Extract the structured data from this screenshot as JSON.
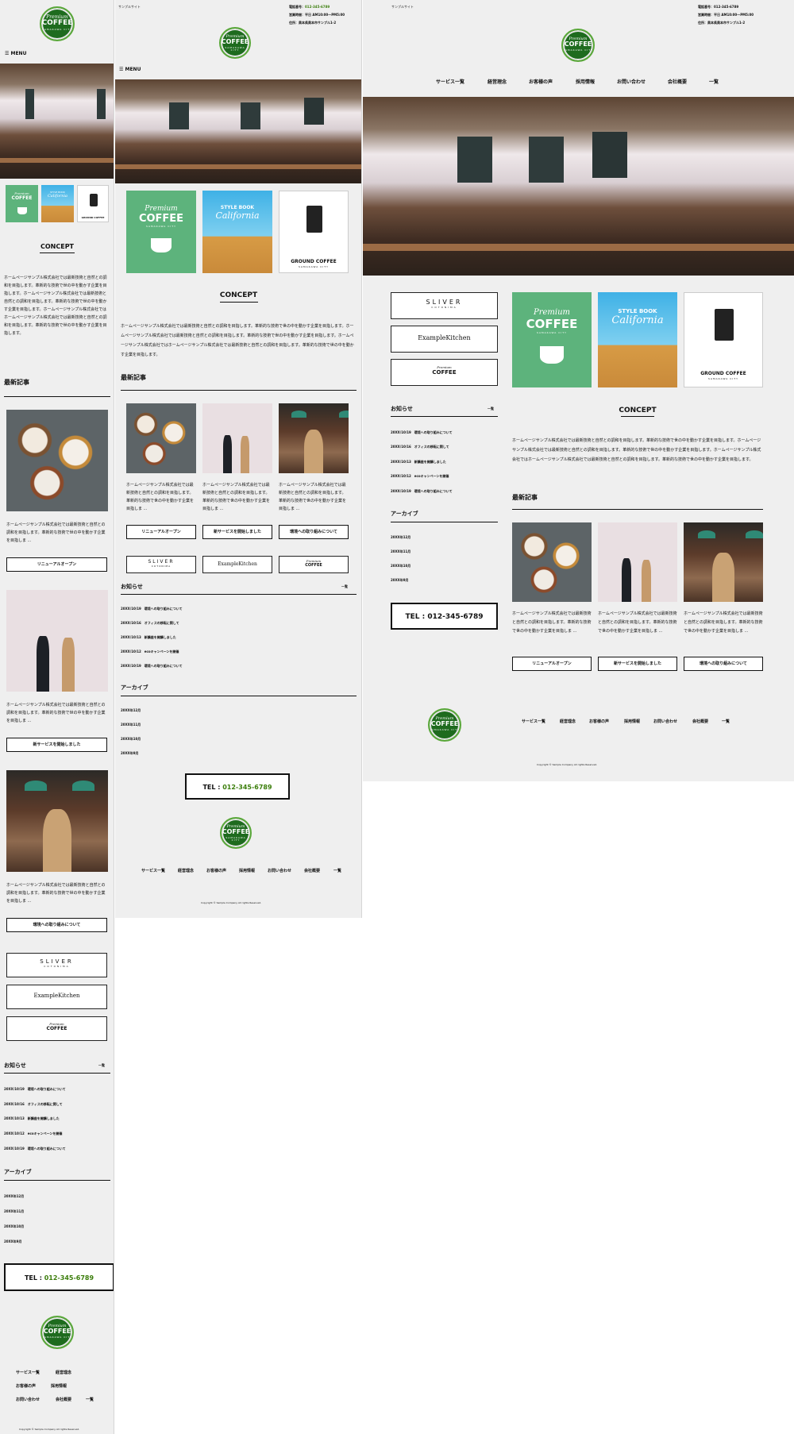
{
  "site": {
    "name": "サンプルサイト",
    "logo": {
      "line1": "Premium",
      "line2": "COFFEE",
      "line3": "SAMAKAWA CITY"
    },
    "phone_label": "電話番号：",
    "phone": "012-345-6789",
    "hours": "営業時間：平日 AM10:00〜PM5:00",
    "address": "住所：奥本県奥本市サンプル1-2"
  },
  "menu_label": "MENU",
  "nav": [
    "サービス一覧",
    "経営理念",
    "お客様の声",
    "採用情報",
    "お問い合わせ",
    "会社概要",
    "一覧"
  ],
  "tiles": {
    "premium": {
      "line1": "Premium",
      "line2": "COFFEE",
      "line3": "SAMAKAWA CITY"
    },
    "california": {
      "line1": "STYLE BOOK",
      "line2": "California"
    },
    "ground": {
      "line1": "GROUND COFFEE",
      "line2": "SAMAKAWA CITY"
    }
  },
  "concept": {
    "title": "CONCEPT",
    "text": "ホームページサンプル株式会社では最新技術と自然との調和を目指します。革新的な技術で世の中を動かす企業を目指します。ホームページサンプル株式会社では最新技術と自然との調和を目指します。革新的な技術で世の中を動かす企業を目指します。ホームページサンプル株式会社ではホームページサンプル株式会社では最新技術と自然との調和を目指します。革新的な技術で世の中を動かす企業を目指します。"
  },
  "latest": {
    "title": "最新記事",
    "excerpt": "ホームページサンプル株式会社では最新技術と自然との調和を目指します。革新的な技術で世の中を動かす企業を目指しま ...",
    "buttons": [
      "リニューアルオープン",
      "新サービスを開始しました",
      "環境への取り組みについて"
    ]
  },
  "banners": {
    "sliver": {
      "line1": "SLIVER",
      "line2": "COTONIMA"
    },
    "kitchen": {
      "line1": "ExampleKitchen"
    },
    "coffee": {
      "line1": "Premium",
      "line2": "COFFEE"
    }
  },
  "news": {
    "title": "お知らせ",
    "more": "一覧",
    "items": [
      "20XX/10/19　環境への取り組みについて",
      "20XX/10/16　オフィスの移転に関して",
      "20XX/10/13　新講座を開講しました",
      "20XX/10/12　ecoキャンペーンを開催",
      "20XX/10/19　環境への取り組みについて"
    ]
  },
  "archive": {
    "title": "アーカイブ",
    "items": [
      "20XX年12月",
      "20XX年11月",
      "20XX年10月",
      "20XX年9月"
    ]
  },
  "tel": {
    "label": "TEL : ",
    "number": "012-345-6789"
  },
  "copyright": "Copyright © Sample Company All rights Reserved."
}
